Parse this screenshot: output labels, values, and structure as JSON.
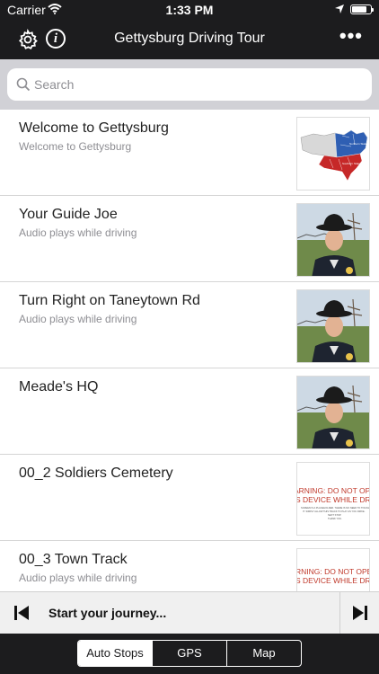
{
  "status": {
    "carrier": "Carrier",
    "time": "1:33 PM"
  },
  "nav": {
    "title": "Gettysburg Driving Tour",
    "settings_icon": "gear-icon",
    "info_icon": "info-icon",
    "more_icon": "more-icon"
  },
  "search": {
    "placeholder": "Search"
  },
  "items": [
    {
      "title": "Welcome to Gettysburg",
      "subtitle": "Welcome to Gettysburg",
      "thumb": "us-map"
    },
    {
      "title": "Your Guide Joe",
      "subtitle": "Audio plays while driving",
      "thumb": "guide-photo"
    },
    {
      "title": "Turn Right on Taneytown Rd",
      "subtitle": "Audio plays while driving",
      "thumb": "guide-photo"
    },
    {
      "title": "Meade's HQ",
      "subtitle": "",
      "thumb": "guide-photo"
    },
    {
      "title": "00_2 Soldiers Cemetery",
      "subtitle": "",
      "thumb": "warning-card",
      "warning": {
        "line1": "ARNING: DO NOT OPERATE",
        "line2": "S DEVICE WHILE DRIVING",
        "small1": "SCREEN IS A PLACEHOLDER. THERE IS NO NEED TO TOUCH",
        "small2": "IT. SIMPLY ALLOW THIS TRACK TO PLAY AS YOU DRIVE.",
        "small3": "NEXT STOP.",
        "small4": "THANK YOU."
      }
    },
    {
      "title": "00_3 Town Track",
      "subtitle": "Audio plays while driving",
      "thumb": "warning-card",
      "warning": {
        "line1": "RNING: DO NOT OPERATE",
        "line2": "S DEVICE WHILE DRIVING",
        "small1": "",
        "small2": "",
        "small3": "",
        "small4": ""
      }
    }
  ],
  "player": {
    "label": "Start your journey..."
  },
  "tabs": [
    {
      "label": "Auto Stops",
      "active": true
    },
    {
      "label": "GPS",
      "active": false
    },
    {
      "label": "Map",
      "active": false
    }
  ],
  "colors": {
    "bar": "#1c1c1e",
    "warning_red": "#c0392b"
  }
}
